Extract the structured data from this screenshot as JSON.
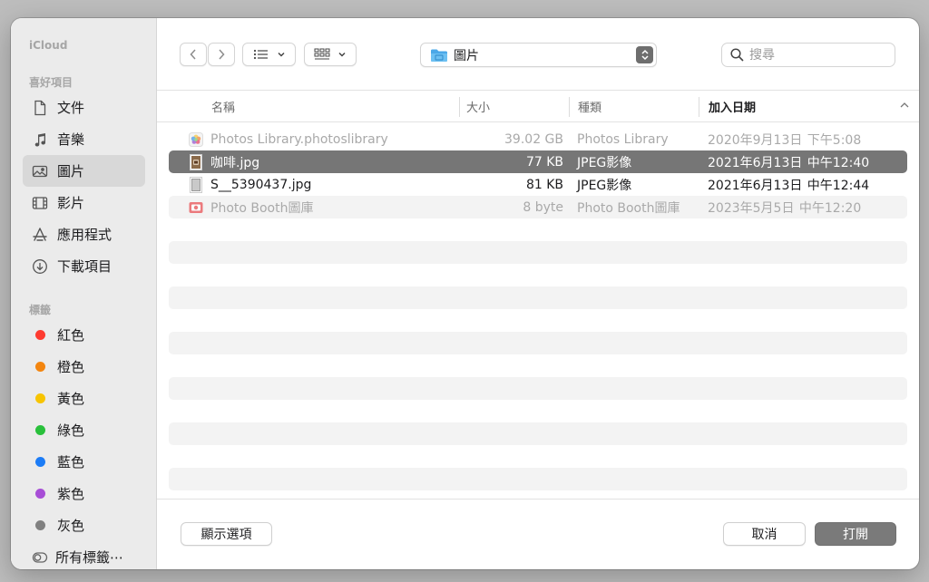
{
  "sidebar": {
    "icloud_heading": "iCloud",
    "favorites_heading": "喜好項目",
    "favorites": [
      {
        "label": "文件",
        "icon": "document-icon"
      },
      {
        "label": "音樂",
        "icon": "music-note-icon"
      },
      {
        "label": "圖片",
        "icon": "photo-icon",
        "selected": true
      },
      {
        "label": "影片",
        "icon": "film-icon"
      },
      {
        "label": "應用程式",
        "icon": "applications-icon"
      },
      {
        "label": "下載項目",
        "icon": "download-icon"
      }
    ],
    "tags_heading": "標籤",
    "tags": [
      {
        "label": "紅色",
        "color": "#fe3b30"
      },
      {
        "label": "橙色",
        "color": "#f3850f"
      },
      {
        "label": "黃色",
        "color": "#f7c400"
      },
      {
        "label": "綠色",
        "color": "#29c03b"
      },
      {
        "label": "藍色",
        "color": "#1c7cf6"
      },
      {
        "label": "紫色",
        "color": "#a74ed6"
      },
      {
        "label": "灰色",
        "color": "#808080"
      }
    ],
    "all_tags": "所有標籤⋯"
  },
  "toolbar": {
    "path_label": "圖片",
    "search_placeholder": "搜尋"
  },
  "columns": {
    "name": "名稱",
    "size": "大小",
    "kind": "種類",
    "date_added": "加入日期"
  },
  "files": [
    {
      "name": "Photos Library.photoslibrary",
      "size": "39.02 GB",
      "kind": "Photos Library",
      "date": "2020年9月13日 下午5:08",
      "dim": true,
      "icon": "photos-library-icon"
    },
    {
      "name": "咖啡.jpg",
      "size": "77 KB",
      "kind": "JPEG影像",
      "date": "2021年6月13日 中午12:40",
      "selected": true,
      "icon": "jpeg-thumbnail-icon"
    },
    {
      "name": "S__5390437.jpg",
      "size": "81 KB",
      "kind": "JPEG影像",
      "date": "2021年6月13日 中午12:44",
      "icon": "jpeg-thumbnail-icon"
    },
    {
      "name": "Photo Booth圖庫",
      "size": "8 byte",
      "kind": "Photo Booth圖庫",
      "date": "2023年5月5日 中午12:20",
      "dim": true,
      "icon": "photo-booth-icon"
    }
  ],
  "buttons": {
    "options": "顯示選項",
    "cancel": "取消",
    "open": "打開"
  }
}
